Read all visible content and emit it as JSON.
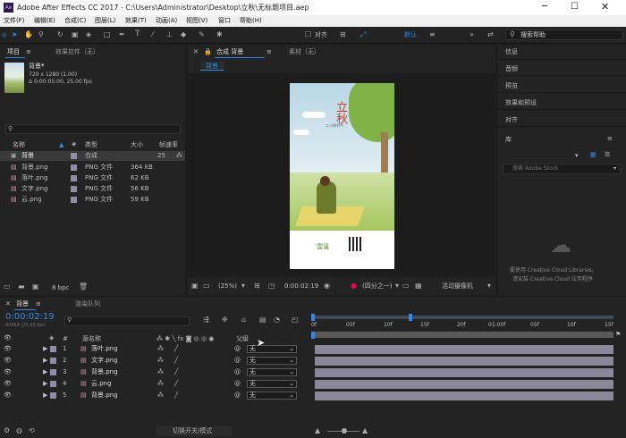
{
  "window": {
    "title": "Adobe After Effects CC 2017 - C:\\Users\\Administrator\\Desktop\\立秋\\无标题项目.aep",
    "app_icon": "Ae"
  },
  "menu": [
    "文件(F)",
    "编辑(E)",
    "合成(C)",
    "图层(L)",
    "效果(T)",
    "动画(A)",
    "视图(V)",
    "窗口",
    "帮助(H)"
  ],
  "toolbar": {
    "snap_label": "对齐",
    "workspace_default": "默认",
    "search_help_placeholder": "搜索帮助"
  },
  "project_panel": {
    "tabs": [
      "项目",
      "效果控件（无）"
    ],
    "selected_item": {
      "name": "背景",
      "dims": "720 x 1280 (1.00)",
      "duration": "Δ 0:00:05:00, 25.00 fps"
    },
    "columns": {
      "name": "名称",
      "type": "类型",
      "size": "大小",
      "fps": "帧速率"
    },
    "items": [
      {
        "name": "背景",
        "type": "合成",
        "size": "",
        "fps": "25"
      },
      {
        "name": "背景.png",
        "type": "PNG 文件",
        "size": "364 KB",
        "fps": ""
      },
      {
        "name": "落叶.png",
        "type": "PNG 文件",
        "size": "62 KB",
        "fps": ""
      },
      {
        "name": "文字.png",
        "type": "PNG 文件",
        "size": "56 KB",
        "fps": ""
      },
      {
        "name": "云.png",
        "type": "PNG 文件",
        "size": "59 KB",
        "fps": ""
      }
    ],
    "bpc": "8 bpc"
  },
  "comp_panel": {
    "tab_label": "合成 背景",
    "footage_tab": "素材（无）",
    "breadcrumb": "背景",
    "poster_title": "立秋",
    "poster_sub": "二十四节气",
    "poster_brand": "雲溪",
    "zoom": "(25%)",
    "timecode": "0:00:02:19",
    "resolution": "(四分之一)",
    "camera": "活动摄像机"
  },
  "right_panels": [
    "信息",
    "音频",
    "预览",
    "效果和预设",
    "对齐",
    "库"
  ],
  "library": {
    "search_placeholder": "搜索 Adobe Stock",
    "cc_message_1": "要使用 Creative Cloud Libraries,",
    "cc_message_2": "请安装 Creative Cloud 应用程序"
  },
  "timeline": {
    "tabs": [
      "背景",
      "渲染队列"
    ],
    "timecode": "0:00:02:19",
    "frame_info": "00069 (25.00 fps)",
    "columns": {
      "num": "#",
      "src": "源名称",
      "parent": "父级"
    },
    "ruler": [
      "0f",
      "05f",
      "10f",
      "15f",
      "20f",
      "01:00f",
      "05f",
      "10f",
      "15f"
    ],
    "layers": [
      {
        "num": "1",
        "name": "落叶.png",
        "parent": "无"
      },
      {
        "num": "2",
        "name": "文字.png",
        "parent": "无"
      },
      {
        "num": "3",
        "name": "背景.png",
        "parent": "无"
      },
      {
        "num": "4",
        "name": "云.png",
        "parent": "无"
      },
      {
        "num": "5",
        "name": "背景.png",
        "parent": "无"
      }
    ],
    "toggle_label": "切换开关/模式"
  },
  "colors": {
    "accent": "#2d8ceb",
    "layer_bar": "#8a879a",
    "label": "#8f8ca8"
  }
}
